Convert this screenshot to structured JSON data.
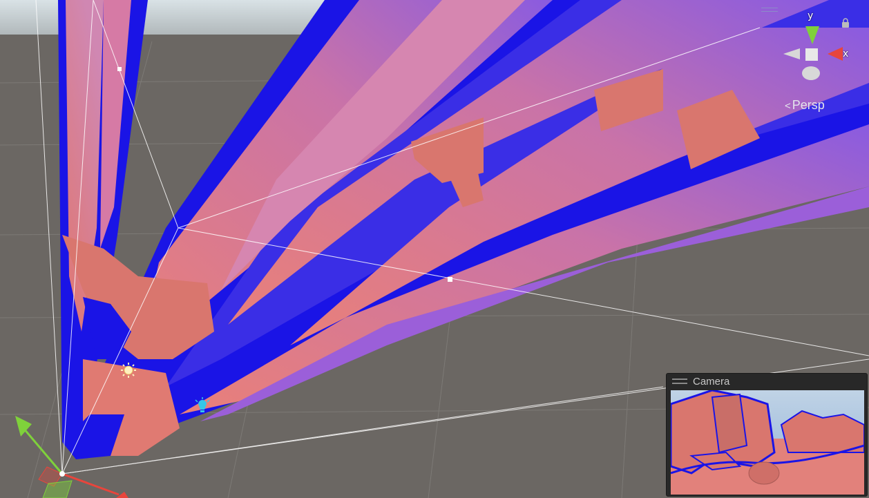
{
  "scene_view": {
    "orientation_gizmo": {
      "y_label": "y",
      "x_label": "x",
      "projection_label": "Persp",
      "colors": {
        "y_axis": "#7fd13b",
        "x_axis": "#e8453c",
        "neutral": "#d8d8d8"
      }
    },
    "icons": [
      "directional-light-icon",
      "point-light-icon",
      "transform-move-gizmo",
      "lock-icon"
    ],
    "colors": {
      "ground": "#6b6763",
      "sky": "#cfd6dc",
      "geometry_front": "#e58079",
      "geometry_side": "#1a14e6",
      "frustum_lines": "#ffffff"
    }
  },
  "camera_preview": {
    "title": "Camera"
  }
}
